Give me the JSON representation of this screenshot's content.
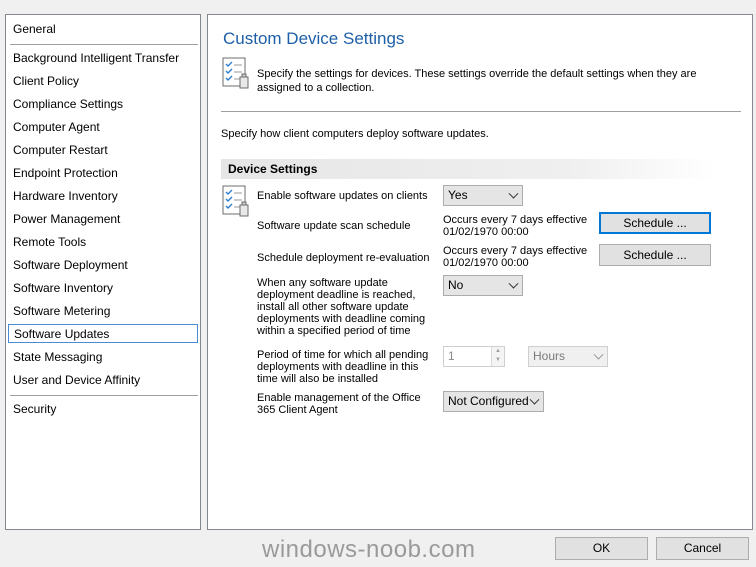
{
  "nav": {
    "items": [
      {
        "label": "General"
      },
      {
        "label": "Background Intelligent Transfer"
      },
      {
        "label": "Client Policy"
      },
      {
        "label": "Compliance Settings"
      },
      {
        "label": "Computer Agent"
      },
      {
        "label": "Computer Restart"
      },
      {
        "label": "Endpoint Protection"
      },
      {
        "label": "Hardware Inventory"
      },
      {
        "label": "Power Management"
      },
      {
        "label": "Remote Tools"
      },
      {
        "label": "Software Deployment"
      },
      {
        "label": "Software Inventory"
      },
      {
        "label": "Software Metering"
      },
      {
        "label": "Software Updates"
      },
      {
        "label": "State Messaging"
      },
      {
        "label": "User and Device Affinity"
      },
      {
        "label": "Security"
      }
    ],
    "selected": "Software Updates"
  },
  "panel": {
    "title": "Custom Device Settings",
    "description": "Specify the settings for devices. These settings override the default settings when they are assigned to a collection.",
    "intro": "Specify how client computers deploy software updates.",
    "section_title": "Device Settings",
    "settings": {
      "enable_updates": {
        "label": "Enable software updates on clients",
        "value": "Yes"
      },
      "scan_schedule": {
        "label": "Software update scan schedule",
        "value_line1": "Occurs every 7 days effective",
        "value_line2": "01/02/1970 00:00",
        "button": "Schedule ..."
      },
      "reevaluation": {
        "label": "Schedule deployment re-evaluation",
        "value_line1": "Occurs every 7 days effective",
        "value_line2": "01/02/1970 00:00",
        "button": "Schedule ..."
      },
      "deadline": {
        "label": "When any software update deployment deadline is reached, install all other software update deployments with deadline coming within a specified period of time",
        "value": "No"
      },
      "period": {
        "label": "Period of time for which all pending deployments with deadline in this time will also be installed",
        "value": "1",
        "unit": "Hours"
      },
      "office365": {
        "label": "Enable management of the Office 365 Client Agent",
        "value": "Not Configured"
      }
    }
  },
  "footer": {
    "watermark": "windows-noob.com",
    "ok_label": "OK",
    "cancel_label": "Cancel"
  },
  "colors": {
    "title": "#1e5fa8",
    "focus": "#0078d7"
  },
  "icons": [
    "checklist-document-icon"
  ]
}
